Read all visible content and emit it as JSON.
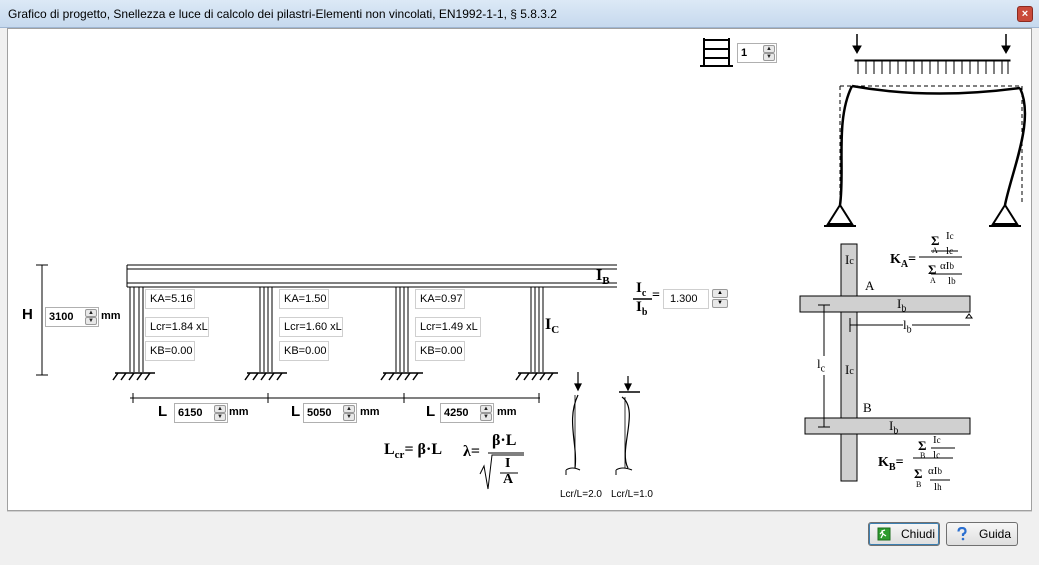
{
  "window": {
    "title": "Grafico di progetto, Snellezza e luce di calcolo dei pilastri-Elementi non vincolati,  EN1992-1-1, § 5.8.3.2",
    "close_glyph": "×"
  },
  "floors": {
    "value": "1"
  },
  "height": {
    "label": "H",
    "value": "3100",
    "unit": "mm"
  },
  "spans": [
    {
      "label": "L",
      "value": "6150",
      "unit": "mm"
    },
    {
      "label": "L",
      "value": "5050",
      "unit": "mm"
    },
    {
      "label": "L",
      "value": "4250",
      "unit": "mm"
    }
  ],
  "columns": [
    {
      "ka": "KA=5.16",
      "lcr": "Lcr=1.84 xL",
      "kb": "KB=0.00"
    },
    {
      "ka": "KA=1.50",
      "lcr": "Lcr=1.60 xL",
      "kb": "KB=0.00"
    },
    {
      "ka": "KA=0.97",
      "lcr": "Lcr=1.49 xL",
      "kb": "KB=0.00"
    }
  ],
  "ratio": {
    "value": "1.300",
    "num": "I",
    "num_sub": "c",
    "den": "I",
    "den_sub": "b"
  },
  "beam_label": {
    "main": "I",
    "sub": "B"
  },
  "column_label": {
    "main": "I",
    "sub": "C"
  },
  "formulas": {
    "lcr": "L",
    "lcr_sub": "cr",
    "lcr_rhs": "= β·L",
    "lambda": "λ",
    "eq": "=",
    "beta_l": "β·L",
    "i": "I",
    "a": "A"
  },
  "buckling": [
    {
      "caption": "Lcr/L=2.0"
    },
    {
      "caption": "Lcr/L=1.0"
    }
  ],
  "stiffness": {
    "ic_top": "I",
    "ic_sub": "c",
    "ib": "I",
    "ib_sub": "b",
    "lb": "l",
    "lb_sub": "b",
    "lc": "l",
    "lc_sub": "c",
    "node_a": "A",
    "node_b": "B",
    "ka": "K",
    "ka_sub": "A",
    "kb": "K",
    "kb_sub": "B",
    "sigma": "Σ",
    "alpha_ib": "αI",
    "b_sub": "b",
    "lh": "l",
    "h_sub": "h"
  },
  "buttons": {
    "close": "Chiudi",
    "help": "Guida"
  },
  "colors": {
    "panel": "#ffffff",
    "dialog": "#f0f0f0",
    "close_icon": "#2e9b2e",
    "help_icon": "#2b6fd0",
    "column_fill": "#d0d0d0"
  }
}
